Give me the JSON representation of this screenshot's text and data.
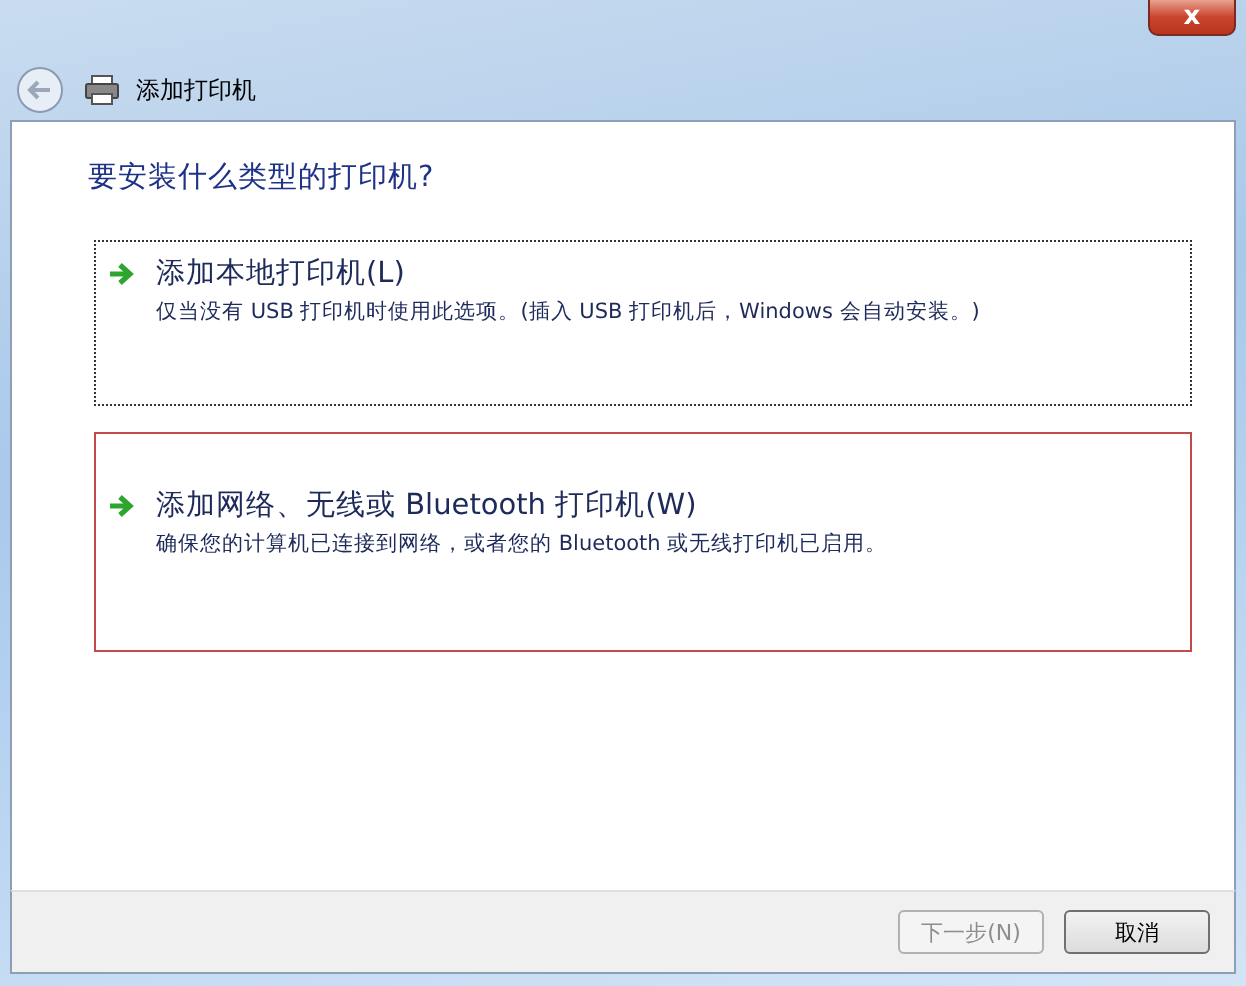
{
  "window": {
    "title": "添加打印机",
    "close_symbol": "x"
  },
  "heading": "要安装什么类型的打印机?",
  "options": [
    {
      "label": "添加本地打印机(L)",
      "description": "仅当没有 USB 打印机时使用此选项。(插入 USB 打印机后，Windows 会自动安装。)",
      "selected": false,
      "focused": true
    },
    {
      "label": "添加网络、无线或 Bluetooth 打印机(W)",
      "description": "确保您的计算机已连接到网络，或者您的 Bluetooth 或无线打印机已启用。",
      "selected": true,
      "focused": false
    }
  ],
  "buttons": [
    {
      "label": "下一步(N)",
      "disabled": true
    },
    {
      "label": "取消",
      "disabled": false
    }
  ]
}
